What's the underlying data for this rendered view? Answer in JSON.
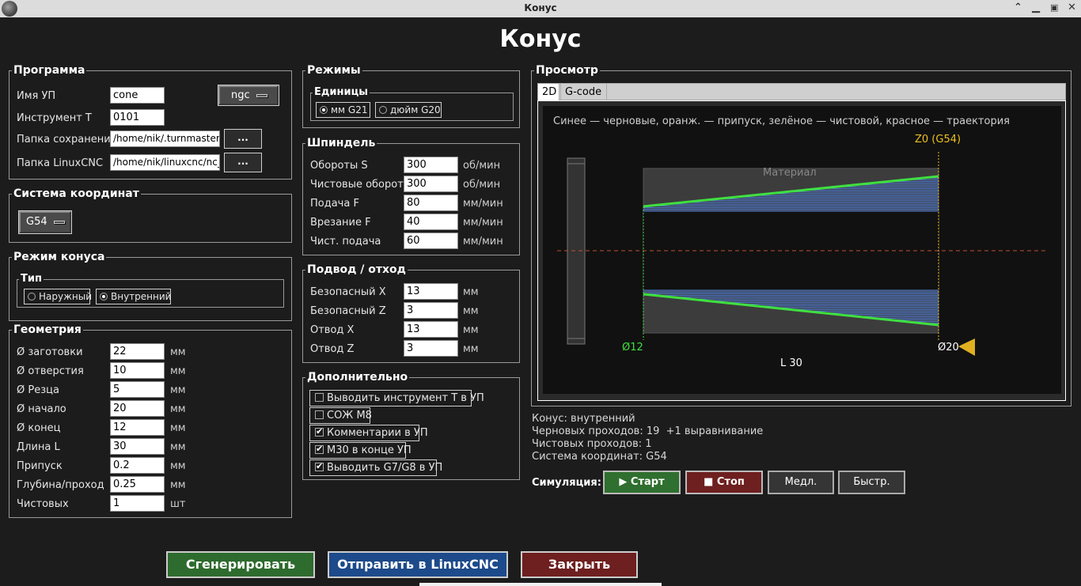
{
  "window": {
    "title": "Конус"
  },
  "app": {
    "title": "Конус"
  },
  "program": {
    "title": "Программа",
    "name_label": "Имя УП",
    "name_value": "cone",
    "format_value": "ngc",
    "tool_label": "Инструмент T",
    "tool_value": "0101",
    "save_folder_label": "Папка сохранения",
    "save_folder_value": "/home/nik/.turnmaster/ge",
    "linuxcnc_folder_label": "Папка LinuxCNC",
    "linuxcnc_folder_value": "/home/nik/linuxcnc/nc_fil",
    "browse_label": "..."
  },
  "coords": {
    "title": "Система координат",
    "value": "G54"
  },
  "cone_mode": {
    "title": "Режим конуса",
    "type_title": "Тип",
    "outer_label": "Наружный",
    "inner_label": "Внутренний",
    "selected": "inner"
  },
  "geometry": {
    "title": "Геометрия",
    "rows": [
      {
        "label": "Ø заготовки",
        "value": "22",
        "unit": "мм"
      },
      {
        "label": "Ø отверстия",
        "value": "10",
        "unit": "мм"
      },
      {
        "label": "Ø Резца",
        "value": "5",
        "unit": "мм"
      },
      {
        "label": "Ø начало",
        "value": "20",
        "unit": "мм"
      },
      {
        "label": "Ø конец",
        "value": "12",
        "unit": "мм"
      },
      {
        "label": "Длина L",
        "value": "30",
        "unit": "мм"
      },
      {
        "label": "Припуск",
        "value": "0.2",
        "unit": "мм"
      },
      {
        "label": "Глубина/проход",
        "value": "0.25",
        "unit": "мм"
      },
      {
        "label": "Чистовых",
        "value": "1",
        "unit": "шт"
      }
    ]
  },
  "modes": {
    "title": "Режимы",
    "units_title": "Единицы",
    "mm_label": "мм G21",
    "inch_label": "дюйм G20",
    "selected": "mm"
  },
  "spindle": {
    "title": "Шпиндель",
    "rows": [
      {
        "label": "Обороты S",
        "value": "300",
        "unit": "об/мин"
      },
      {
        "label": "Чистовые обороты",
        "value": "300",
        "unit": "об/мин"
      },
      {
        "label": "Подача F",
        "value": "80",
        "unit": "мм/мин"
      },
      {
        "label": "Врезание F",
        "value": "40",
        "unit": "мм/мин"
      },
      {
        "label": "Чист. подача",
        "value": "60",
        "unit": "мм/мин"
      }
    ]
  },
  "approach": {
    "title": "Подвод / отход",
    "rows": [
      {
        "label": "Безопасный X",
        "value": "13",
        "unit": "мм"
      },
      {
        "label": "Безопасный Z",
        "value": "3",
        "unit": "мм"
      },
      {
        "label": "Отвод X",
        "value": "13",
        "unit": "мм"
      },
      {
        "label": "Отвод Z",
        "value": "3",
        "unit": "мм"
      }
    ]
  },
  "extra": {
    "title": "Дополнительно",
    "options": [
      {
        "label": "Выводить инструмент T в УП",
        "checked": false
      },
      {
        "label": "СОЖ M8",
        "checked": false
      },
      {
        "label": "Комментарии в УП",
        "checked": true
      },
      {
        "label": "M30 в конце УП",
        "checked": true
      },
      {
        "label": "Выводить G7/G8 в УП",
        "checked": true
      }
    ]
  },
  "preview": {
    "title": "Просмотр",
    "tabs": [
      "2D",
      "G-code"
    ],
    "legend": "Синее — черновые, оранж. — припуск, зелёное — чистовой, красное — траектория",
    "z0_label": "Z0 (G54)",
    "material_label": "Материал",
    "d_small_label": "Ø12",
    "d_big_label": "Ø20",
    "length_label": "L 30",
    "colors": {
      "bg": "#111111",
      "material": "#3c3c3c",
      "roughing": "#4f7fe0",
      "finish": "#3fe03f",
      "z0": "#f0c020",
      "axis": "#c05030"
    }
  },
  "summary": {
    "lines": [
      "Конус: внутренний",
      "Черновых проходов: 19  +1 выравнивание",
      "Чистовых проходов: 1",
      "Система координат: G54"
    ]
  },
  "simulation": {
    "label": "Симуляция:",
    "start": "▶ Старт",
    "stop": "■ Стоп",
    "slow": "Медл.",
    "fast": "Быстр."
  },
  "actions": {
    "generate": "Сгенерировать",
    "send": "Отправить в LinuxCNC",
    "close": "Закрыть"
  }
}
